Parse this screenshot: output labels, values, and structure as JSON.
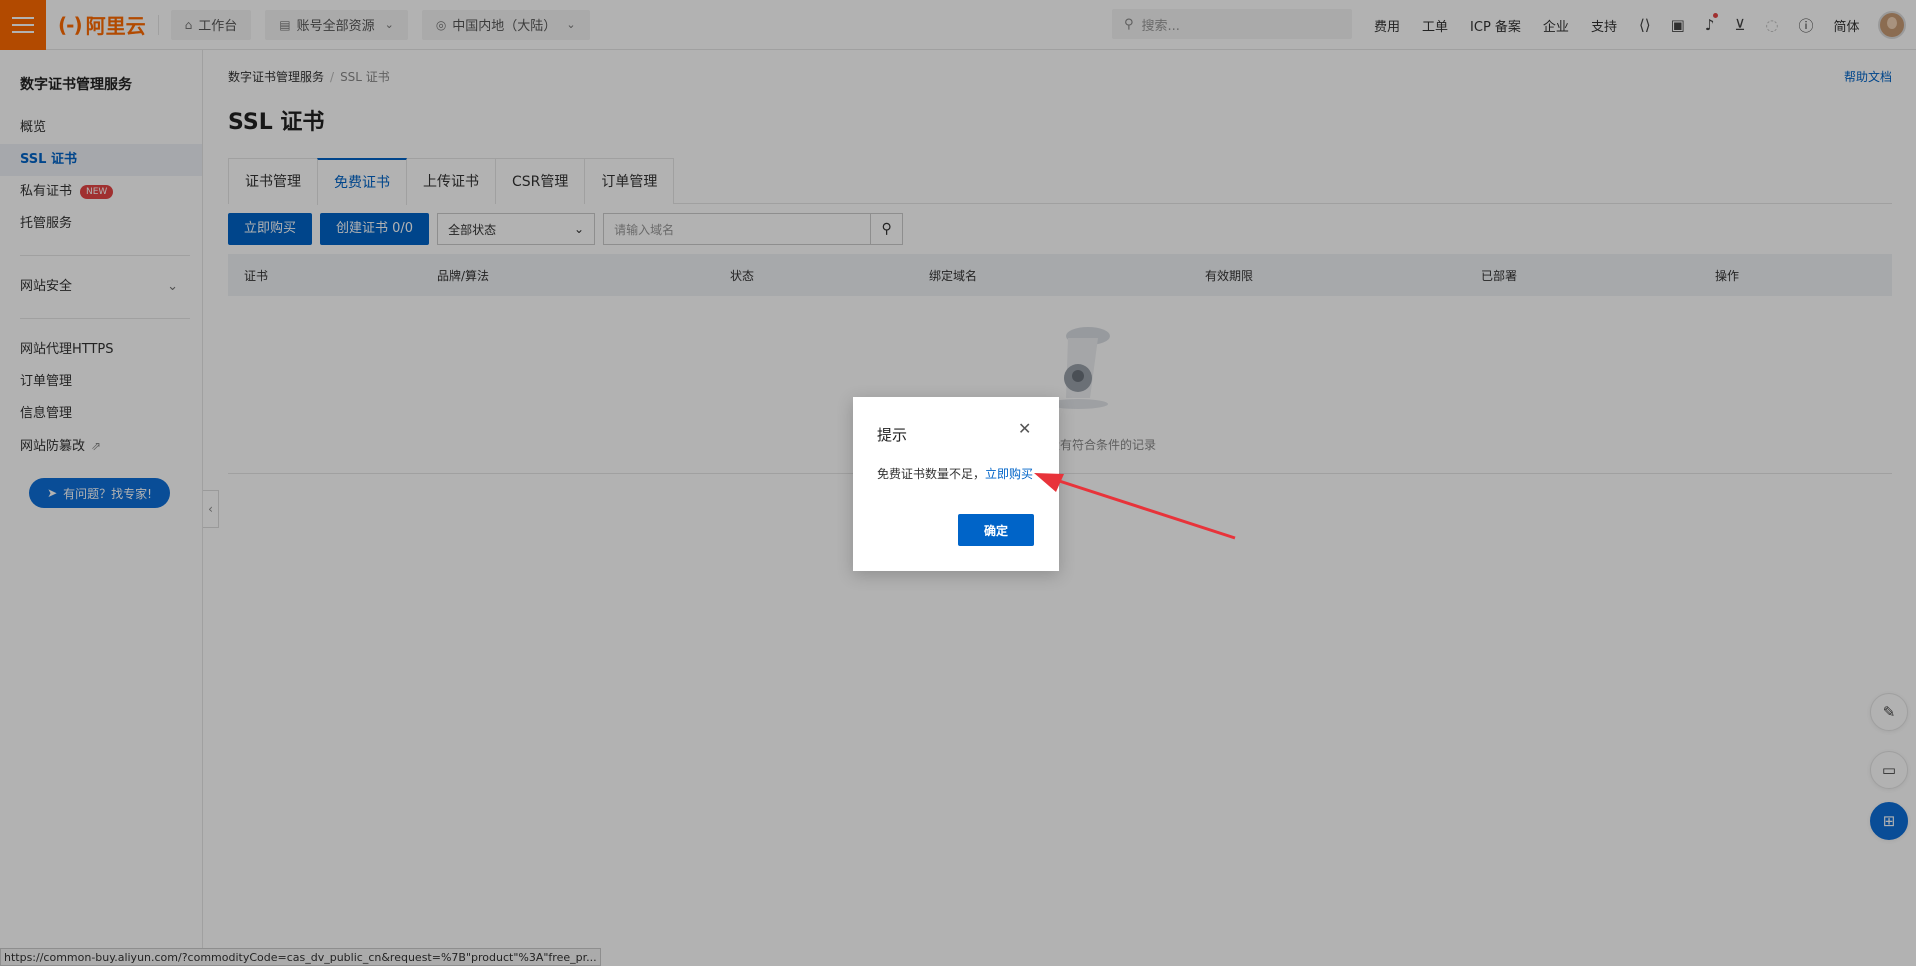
{
  "topbar": {
    "logo_text": "阿里云",
    "workbench": "工作台",
    "resources": "账号全部资源",
    "region": "中国内地（大陆）",
    "search_placeholder": "搜索...",
    "links": [
      "费用",
      "工单",
      "ICP 备案",
      "企业",
      "支持"
    ],
    "lang": "简体",
    "icons": [
      "code-icon",
      "terminal-icon",
      "bell-icon",
      "cart-icon",
      "bulb-icon",
      "help-icon"
    ]
  },
  "sidebar": {
    "title": "数字证书管理服务",
    "items": [
      "概览",
      "SSL 证书",
      "私有证书",
      "托管服务"
    ],
    "new_badge": "NEW",
    "group": "网站安全",
    "items2": [
      "网站代理HTTPS",
      "订单管理",
      "信息管理",
      "网站防篡改"
    ],
    "expert_button": "有问题？找专家!"
  },
  "main": {
    "breadcrumb": [
      "数字证书管理服务",
      "SSL 证书"
    ],
    "help": "帮助文档",
    "title": "SSL 证书",
    "tabs": [
      "证书管理",
      "免费证书",
      "上传证书",
      "CSR管理",
      "订单管理"
    ],
    "buy_button": "立即购买",
    "create_button": "创建证书 0/0",
    "status_select": "全部状态",
    "domain_placeholder": "请输入域名",
    "columns": [
      "证书",
      "品牌/算法",
      "状态",
      "绑定域名",
      "有效期限",
      "已部署",
      "操作"
    ],
    "empty_text": "没有符合条件的记录"
  },
  "modal": {
    "title": "提示",
    "message": "免费证书数量不足，",
    "link": "立即购买",
    "ok": "确定"
  },
  "statusbar": "https://common-buy.aliyun.com/?commodityCode=cas_dv_public_cn&request=%7B\"product\"%3A\"free_pr...",
  "colors": {
    "accent": "#0064c8",
    "brand": "#ff6a00",
    "arrow": "#e8333a"
  }
}
